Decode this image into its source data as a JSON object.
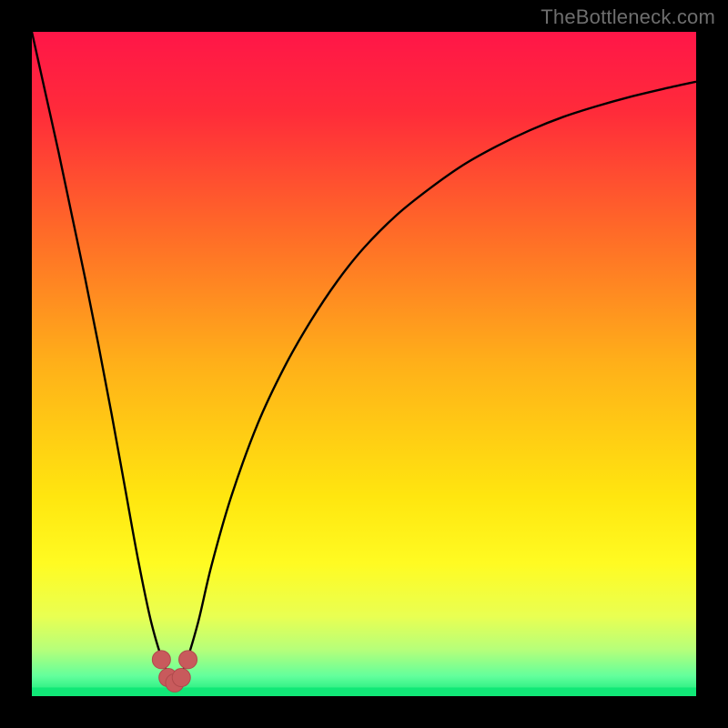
{
  "watermark": "TheBottleneck.com",
  "colors": {
    "black": "#000000",
    "gradient_stops": [
      {
        "offset": 0.0,
        "color": "#ff1648"
      },
      {
        "offset": 0.12,
        "color": "#ff2b3a"
      },
      {
        "offset": 0.3,
        "color": "#ff6a28"
      },
      {
        "offset": 0.5,
        "color": "#ffb019"
      },
      {
        "offset": 0.7,
        "color": "#ffe60f"
      },
      {
        "offset": 0.8,
        "color": "#fffb22"
      },
      {
        "offset": 0.88,
        "color": "#e9ff52"
      },
      {
        "offset": 0.93,
        "color": "#b6ff7a"
      },
      {
        "offset": 0.97,
        "color": "#62ff9c"
      },
      {
        "offset": 1.0,
        "color": "#11e877"
      }
    ],
    "curve": "#000000",
    "marker_fill": "#c85a5c",
    "marker_stroke": "#b04a4c"
  },
  "chart_data": {
    "type": "line",
    "title": "",
    "xlabel": "",
    "ylabel": "",
    "xlim": [
      0,
      1
    ],
    "ylim": [
      0,
      1
    ],
    "series": [
      {
        "name": "bottleneck-curve",
        "x": [
          0.0,
          0.02,
          0.04,
          0.06,
          0.08,
          0.1,
          0.12,
          0.14,
          0.16,
          0.18,
          0.2,
          0.215,
          0.23,
          0.25,
          0.27,
          0.3,
          0.34,
          0.38,
          0.42,
          0.46,
          0.5,
          0.55,
          0.6,
          0.65,
          0.7,
          0.75,
          0.8,
          0.85,
          0.9,
          0.95,
          1.0
        ],
        "y": [
          1.0,
          0.91,
          0.82,
          0.725,
          0.63,
          0.53,
          0.425,
          0.315,
          0.205,
          0.11,
          0.045,
          0.02,
          0.045,
          0.11,
          0.195,
          0.3,
          0.41,
          0.495,
          0.565,
          0.625,
          0.675,
          0.725,
          0.765,
          0.8,
          0.828,
          0.852,
          0.872,
          0.888,
          0.902,
          0.914,
          0.925
        ]
      }
    ],
    "markers": {
      "name": "minimum-u",
      "x": [
        0.195,
        0.205,
        0.215,
        0.225,
        0.235
      ],
      "y": [
        0.055,
        0.028,
        0.02,
        0.028,
        0.055
      ]
    },
    "green_band_y": [
      0.0,
      0.013
    ]
  }
}
